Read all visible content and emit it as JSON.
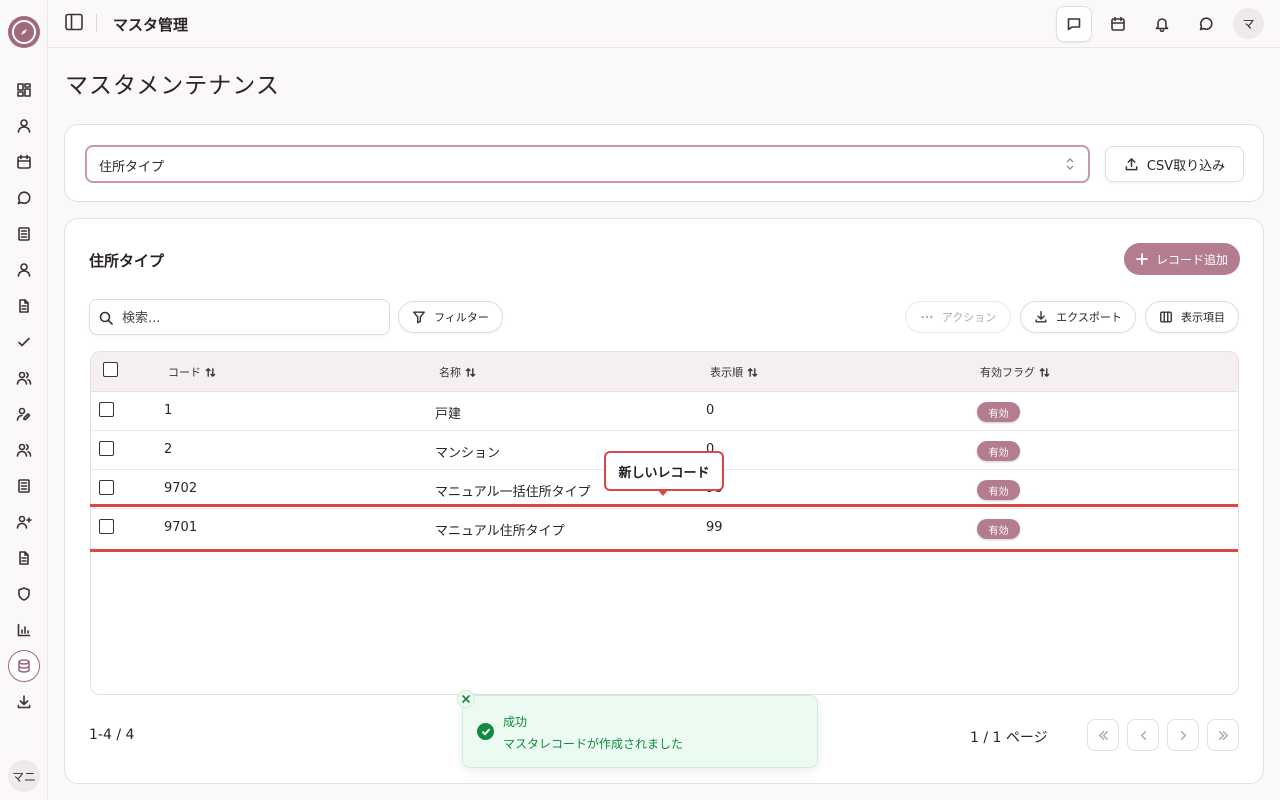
{
  "header": {
    "title": "マスタ管理",
    "avatar": "マ"
  },
  "sidebar": {
    "avatar": "マニ",
    "items": [
      "dashboard-icon",
      "user-icon",
      "calendar-icon",
      "message-icon",
      "notebook-icon",
      "person-icon",
      "file-icon",
      "check-icon",
      "users-icon",
      "user-pen-icon",
      "users-2-icon",
      "list-icon",
      "user-plus-icon",
      "document-icon",
      "shield-icon",
      "chart-icon",
      "database-icon",
      "download-icon"
    ]
  },
  "page": {
    "title": "マスタメンテナンス"
  },
  "selector": {
    "value": "住所タイプ",
    "csv_button": "CSV取り込み"
  },
  "card": {
    "title": "住所タイプ",
    "add_button": "レコード追加",
    "search_placeholder": "検索...",
    "filter_button": "フィルター",
    "action_button": "アクション",
    "export_button": "エクスポート",
    "columns_button": "表示項目"
  },
  "table": {
    "headers": [
      "コード",
      "名称",
      "表示順",
      "有効フラグ"
    ],
    "rows": [
      {
        "code": "1",
        "name": "戸建",
        "order": "0",
        "flag": "有効"
      },
      {
        "code": "2",
        "name": "マンション",
        "order": "0",
        "flag": "有効"
      },
      {
        "code": "9702",
        "name": "マニュアル一括住所タイプ",
        "order": "98",
        "flag": "有効"
      },
      {
        "code": "9701",
        "name": "マニュアル住所タイプ",
        "order": "99",
        "flag": "有効"
      }
    ]
  },
  "callout": "新しいレコード",
  "pagination": {
    "range": "1-4 / 4",
    "page": "1 / 1 ページ"
  },
  "toast": {
    "title": "成功",
    "message": "マスタレコードが作成されました"
  },
  "colors": {
    "accent": "#b47d8d",
    "highlight": "#d94848",
    "success": "#138a42"
  }
}
